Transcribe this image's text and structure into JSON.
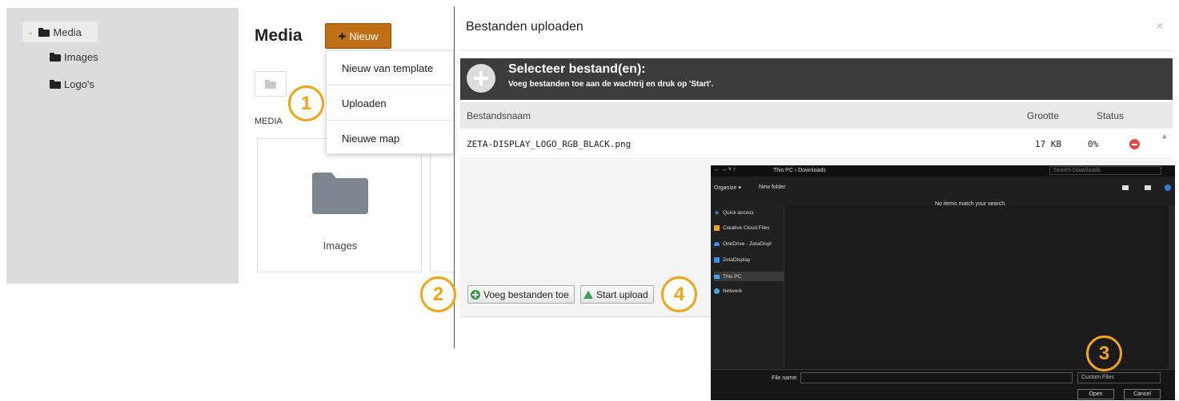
{
  "tree": {
    "items": [
      {
        "label": "Media"
      },
      {
        "label": "Images"
      },
      {
        "label": "Logo's"
      }
    ]
  },
  "media": {
    "title": "Media",
    "new_button": "Nieuw",
    "section_label": "MEDIA",
    "folder_card_label": "Images"
  },
  "new_menu": {
    "items": [
      "Nieuw van template",
      "Uploaden",
      "Nieuwe map"
    ]
  },
  "upload_dialog": {
    "title": "Bestanden uploaden",
    "close": "×",
    "select_title": "Selecteer bestand(en):",
    "select_subtitle": "Voeg bestanden toe aan de wachtrij en druk op 'Start'.",
    "columns": {
      "name": "Bestandsnaam",
      "size": "Grootte",
      "status": "Status"
    },
    "files": [
      {
        "name": "ZETA-DISPLAY_LOGO_RGB_BLACK.png",
        "size": "17 KB",
        "status": "0%"
      }
    ],
    "add_files_button": "Voeg bestanden toe",
    "start_upload_button": "Start upload"
  },
  "file_dialog": {
    "nav_arrows": "← → ˅ ↑",
    "path": "This PC › Downloads",
    "search_placeholder": "Search Downloads",
    "organize": "Organize ▾",
    "new_folder": "New folder",
    "nav_items": [
      {
        "label": "Quick access",
        "icon": "star-icon",
        "color": "#3b8ee8"
      },
      {
        "label": "Creative Cloud Files",
        "icon": "creative-cloud-icon",
        "color": "#f2a11f"
      },
      {
        "label": "OneDrive - ZetaDispl",
        "icon": "cloud-icon",
        "color": "#3b8ee8"
      },
      {
        "label": "ZetaDisplay",
        "icon": "building-icon",
        "color": "#3b8ee8"
      },
      {
        "label": "This PC",
        "icon": "computer-icon",
        "color": "#4aa3e8"
      },
      {
        "label": "Network",
        "icon": "network-icon",
        "color": "#4aa3e8"
      }
    ],
    "empty_message": "No items match your search.",
    "file_name_label": "File name:",
    "file_type": "Custom Files",
    "open_button": "Open",
    "cancel_button": "Cancel"
  },
  "callouts": [
    "1",
    "2",
    "3",
    "4"
  ],
  "colors": {
    "accent_orange": "#f0a418",
    "new_button": "#c07014",
    "dialog_bar": "#3c3c3c",
    "remove_red": "#e04a4a"
  }
}
